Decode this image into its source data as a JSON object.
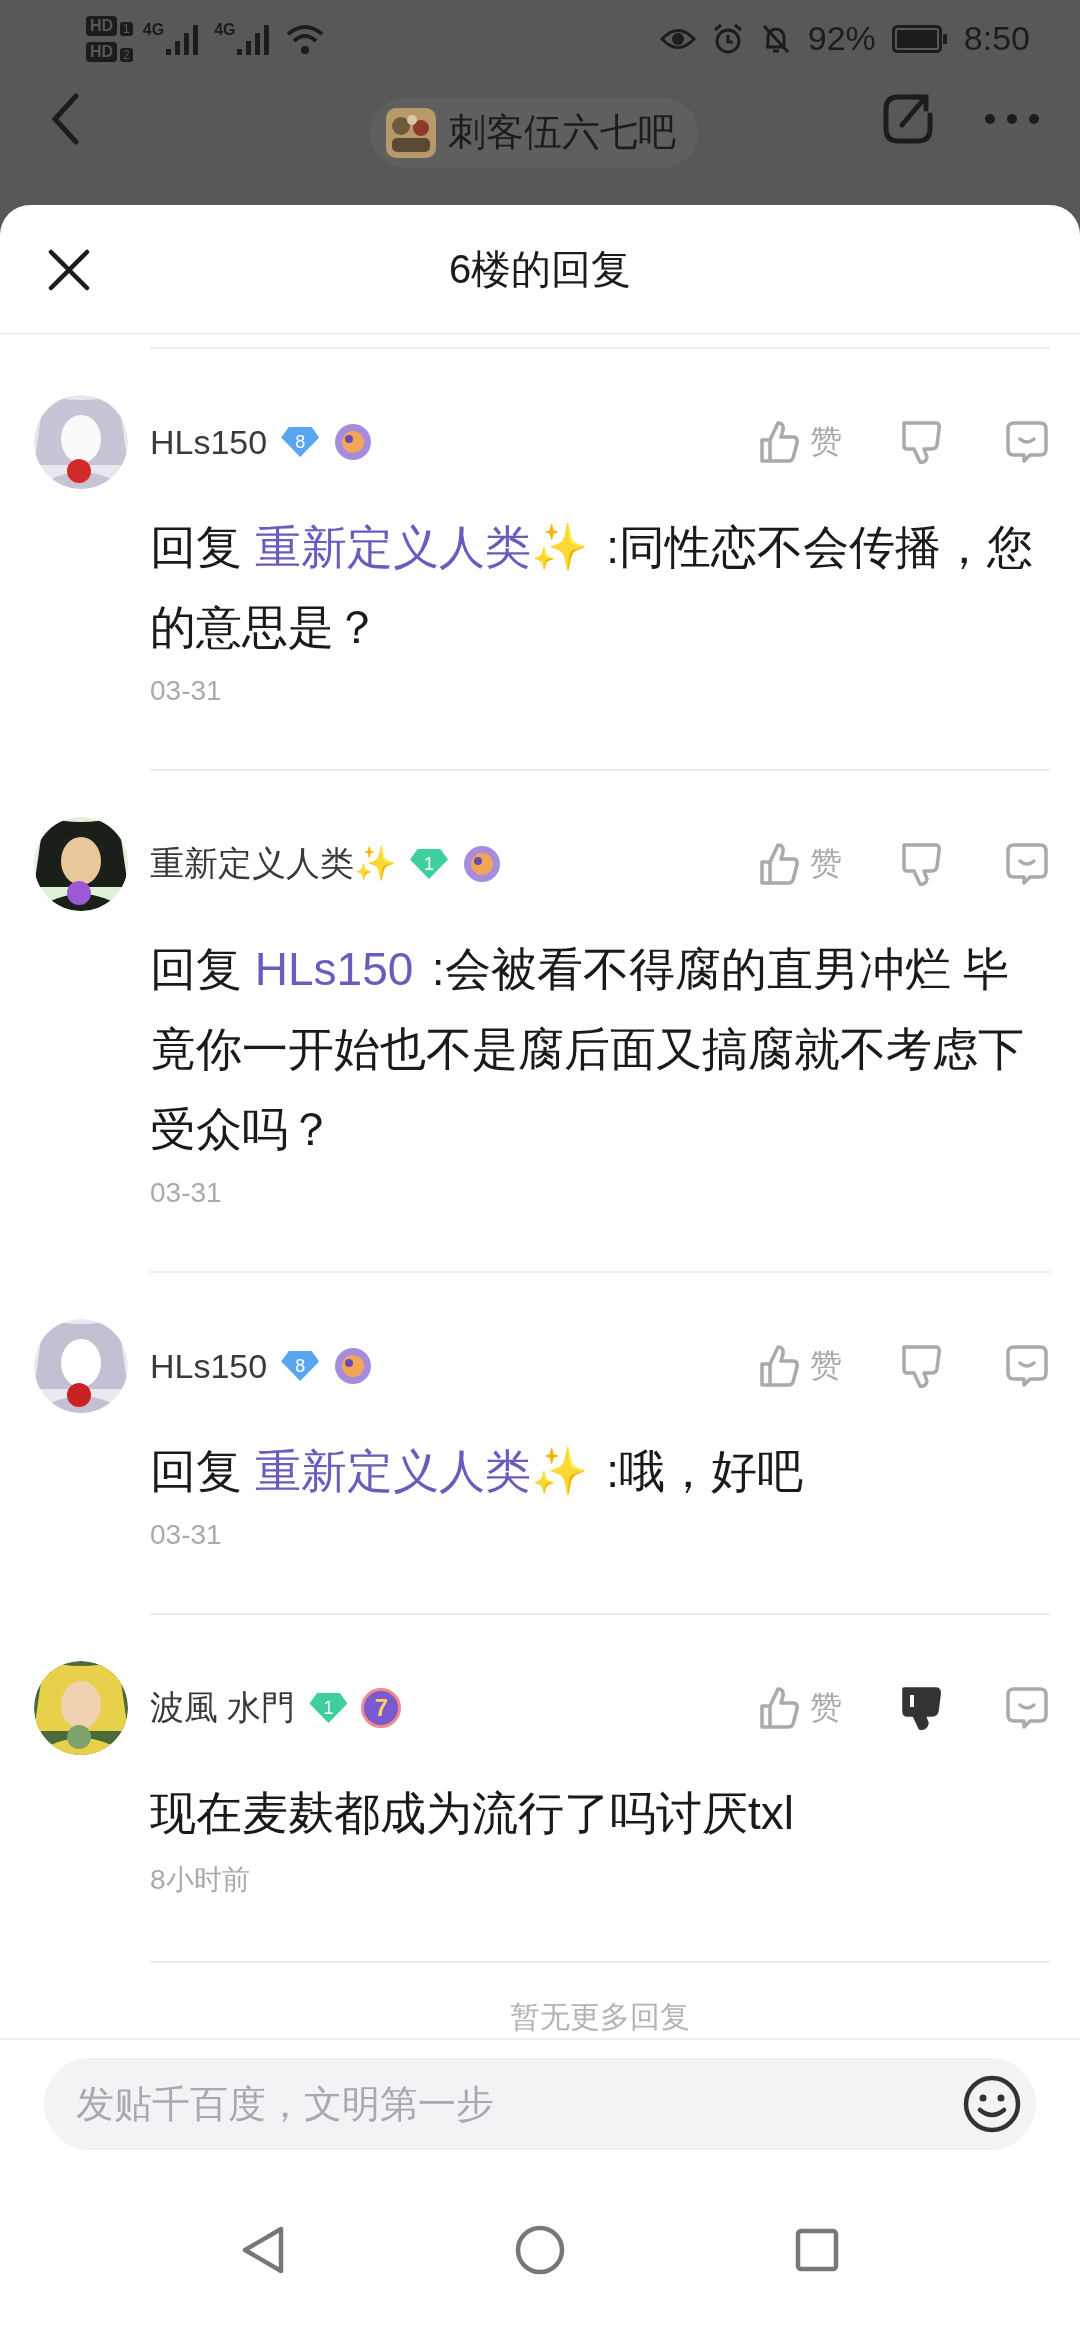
{
  "status_bar": {
    "sims": [
      {
        "label": "HD",
        "slot": "1"
      },
      {
        "label": "HD",
        "slot": "2"
      }
    ],
    "networks": [
      "4G",
      "4G"
    ],
    "battery_text": "92%",
    "time": "8:50"
  },
  "top_bar": {
    "forum": "刺客伍六七吧"
  },
  "sheet": {
    "title": "6楼的回复"
  },
  "replies": [
    {
      "user": "HLs150",
      "level": "8",
      "color": "#5aa5f0",
      "prefix": "回复",
      "reply_to": "重新定义人类✨",
      "text": ":同性恋不会传播，您的意思是？",
      "date": "03-31",
      "like": "赞",
      "disliked": false
    },
    {
      "user": "重新定义人类✨",
      "level": "1",
      "color": "#3fcf9c",
      "prefix": "回复",
      "reply_to": "HLs150",
      "text": ":会被看不得腐的直男冲烂 毕竟你一开始也不是腐后面又搞腐就不考虑下受众吗？",
      "date": "03-31",
      "like": "赞",
      "disliked": false
    },
    {
      "user": "HLs150",
      "level": "8",
      "color": "#5aa5f0",
      "prefix": "回复",
      "reply_to": "重新定义人类✨",
      "text": ":哦，好吧",
      "date": "03-31",
      "like": "赞",
      "disliked": false
    },
    {
      "user": "波風 水門",
      "level": "1",
      "color": "#3fcf9c",
      "medal_text": "7",
      "text": "现在麦麸都成为流行了吗讨厌txl",
      "date": "8小时前",
      "like": "赞",
      "disliked": true
    }
  ],
  "end_note": "暂无更多回复",
  "composer": {
    "placeholder": "发贴千百度，文明第一步"
  }
}
